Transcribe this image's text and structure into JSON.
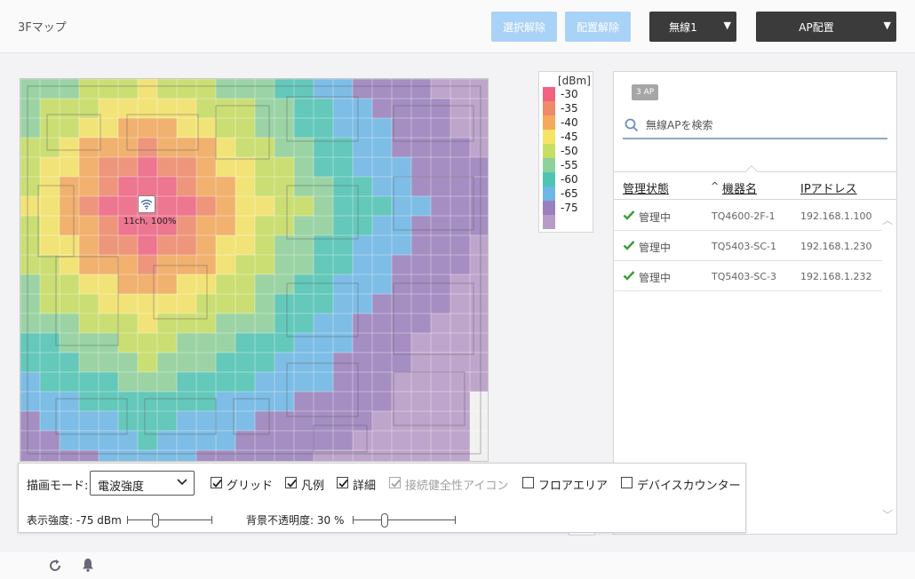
{
  "header": {
    "title": "3Fマップ",
    "deselect_label": "選択解除",
    "unplace_label": "配置解除",
    "radio_select_label": "無線1",
    "ap_place_label": "AP配置"
  },
  "map": {
    "ap_marker": {
      "channel_label": "11ch, 100%",
      "icon": "wifi-icon"
    }
  },
  "legend": {
    "unit": "[dBm]",
    "items": [
      {
        "value": "-30",
        "color": "#f06482"
      },
      {
        "value": "-35",
        "color": "#f08a6a"
      },
      {
        "value": "-40",
        "color": "#f4a95c"
      },
      {
        "value": "-45",
        "color": "#f6e466"
      },
      {
        "value": "-50",
        "color": "#c8de62"
      },
      {
        "value": "-55",
        "color": "#8fd19b"
      },
      {
        "value": "-60",
        "color": "#4fc4b4"
      },
      {
        "value": "-65",
        "color": "#6cb7e8"
      },
      {
        "value": "-75",
        "color": "#9a80bd"
      },
      {
        "value": "",
        "color": "#b99bc8"
      }
    ]
  },
  "ap_panel": {
    "count_badge": "3 AP",
    "search_placeholder": "無線APを検索",
    "columns": {
      "status": "管理状態",
      "device": "機器名",
      "ip": "IPアドレス"
    },
    "rows": [
      {
        "status": "管理中",
        "device": "TQ4600-2F-1",
        "ip": "192.168.1.100"
      },
      {
        "status": "管理中",
        "device": "TQ5403-SC-1",
        "ip": "192.168.1.230"
      },
      {
        "status": "管理中",
        "device": "TQ5403-SC-3",
        "ip": "192.168.1.232"
      }
    ],
    "status_color": "#3a9b3a"
  },
  "controls": {
    "draw_mode_label": "描画モード:",
    "draw_mode_value": "電波強度",
    "checkboxes": {
      "grid": "グリッド",
      "legend": "凡例",
      "detail": "詳細",
      "health_icon": "接続健全性アイコン",
      "floor_area": "フロアエリア",
      "device_counter": "デバイスカウンター"
    },
    "display_strength_label": "表示強度: -75 dBm",
    "display_strength_level": 0.32,
    "bg_opacity_label": "背景不透明度: 30 %",
    "bg_opacity_level": 0.3
  },
  "colors": {
    "accent_light": "#a9d2f7",
    "dark_button": "#3b3b3b"
  }
}
